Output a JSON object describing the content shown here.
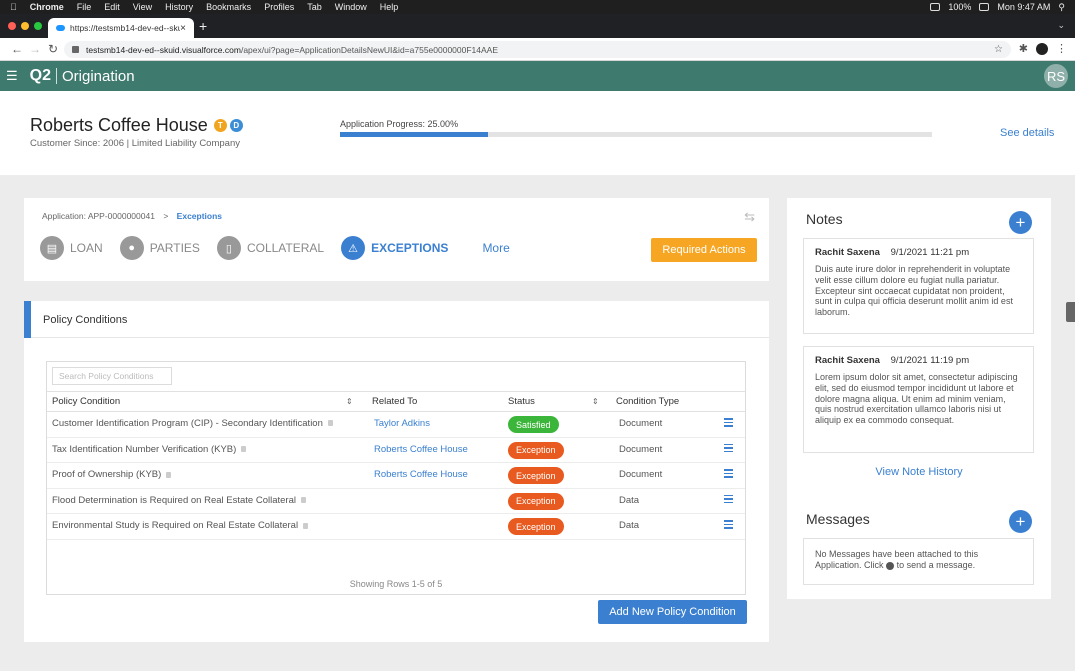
{
  "menubar": {
    "app": "Chrome",
    "items": [
      "File",
      "Edit",
      "View",
      "History",
      "Bookmarks",
      "Profiles",
      "Tab",
      "Window",
      "Help"
    ],
    "battery": "100%",
    "clock": "Mon 9:47 AM"
  },
  "browser": {
    "tab_title": "https://testsmb14-dev-ed--sku",
    "url_host": "testsmb14-dev-ed--skuid.visualforce.com",
    "url_path": "/apex/ui?page=ApplicationDetailsNewUI&id=a755e0000000F14AAE"
  },
  "app": {
    "logo": "Q2",
    "product": "Origination",
    "user_initials": "RS",
    "brand_color": "#3f7a6f",
    "accent_color": "#3b80d0"
  },
  "customer": {
    "name": "Roberts Coffee House",
    "badge_t": "T",
    "badge_d": "D",
    "subtitle": "Customer Since: 2006 | Limited Liability Company",
    "progress_label": "Application Progress:  25.00%",
    "progress_fraction": 0.25,
    "see_details": "See details"
  },
  "application": {
    "crumb_app": "Application: APP-0000000041",
    "crumb_sep": ">",
    "crumb_current": "Exceptions",
    "tabs": [
      {
        "label": "LOAN",
        "icon": "loan-icon"
      },
      {
        "label": "PARTIES",
        "icon": "parties-icon"
      },
      {
        "label": "COLLATERAL",
        "icon": "collateral-icon"
      },
      {
        "label": "EXCEPTIONS",
        "icon": "warning-icon"
      }
    ],
    "more": "More",
    "required_actions": "Required Actions"
  },
  "policy": {
    "title": "Policy Conditions",
    "search_placeholder": "Search Policy Conditions",
    "headers": {
      "condition": "Policy Condition",
      "related": "Related To",
      "status": "Status",
      "type": "Condition Type"
    },
    "rows": [
      {
        "condition": "Customer Identification Program (CIP) - Secondary Identification",
        "related": "Taylor Adkins",
        "status": "Satisfied",
        "type": "Document"
      },
      {
        "condition": "Tax Identification Number Verification (KYB)",
        "related": "Roberts Coffee House",
        "status": "Exception",
        "type": "Document"
      },
      {
        "condition": "Proof of Ownership (KYB)",
        "related": "Roberts Coffee House",
        "status": "Exception",
        "type": "Document"
      },
      {
        "condition": "Flood Determination is Required on Real Estate Collateral",
        "related": "",
        "status": "Exception",
        "type": "Data"
      },
      {
        "condition": "Environmental Study is Required on Real Estate Collateral",
        "related": "",
        "status": "Exception",
        "type": "Data"
      }
    ],
    "showing": "Showing Rows 1-5 of 5",
    "add_button": "Add New Policy Condition"
  },
  "notes": {
    "title": "Notes",
    "items": [
      {
        "author": "Rachit Saxena",
        "date": "9/1/2021 11:21 pm",
        "body": "Duis aute irure dolor in reprehenderit in voluptate velit esse cillum dolore eu fugiat nulla pariatur. Excepteur sint occaecat cupidatat non proident, sunt in culpa qui officia deserunt mollit anim id est laborum."
      },
      {
        "author": "Rachit Saxena",
        "date": "9/1/2021 11:19 pm",
        "body": "Lorem ipsum dolor sit amet, consectetur adipiscing elit, sed do eiusmod tempor incididunt ut labore et dolore magna aliqua. Ut enim ad minim veniam, quis nostrud exercitation ullamco laboris nisi ut aliquip ex ea commodo consequat."
      }
    ],
    "view_history": "View Note History"
  },
  "messages": {
    "title": "Messages",
    "empty_pre": "No Messages have been attached to this Application. Click",
    "empty_post": "to send a message."
  }
}
